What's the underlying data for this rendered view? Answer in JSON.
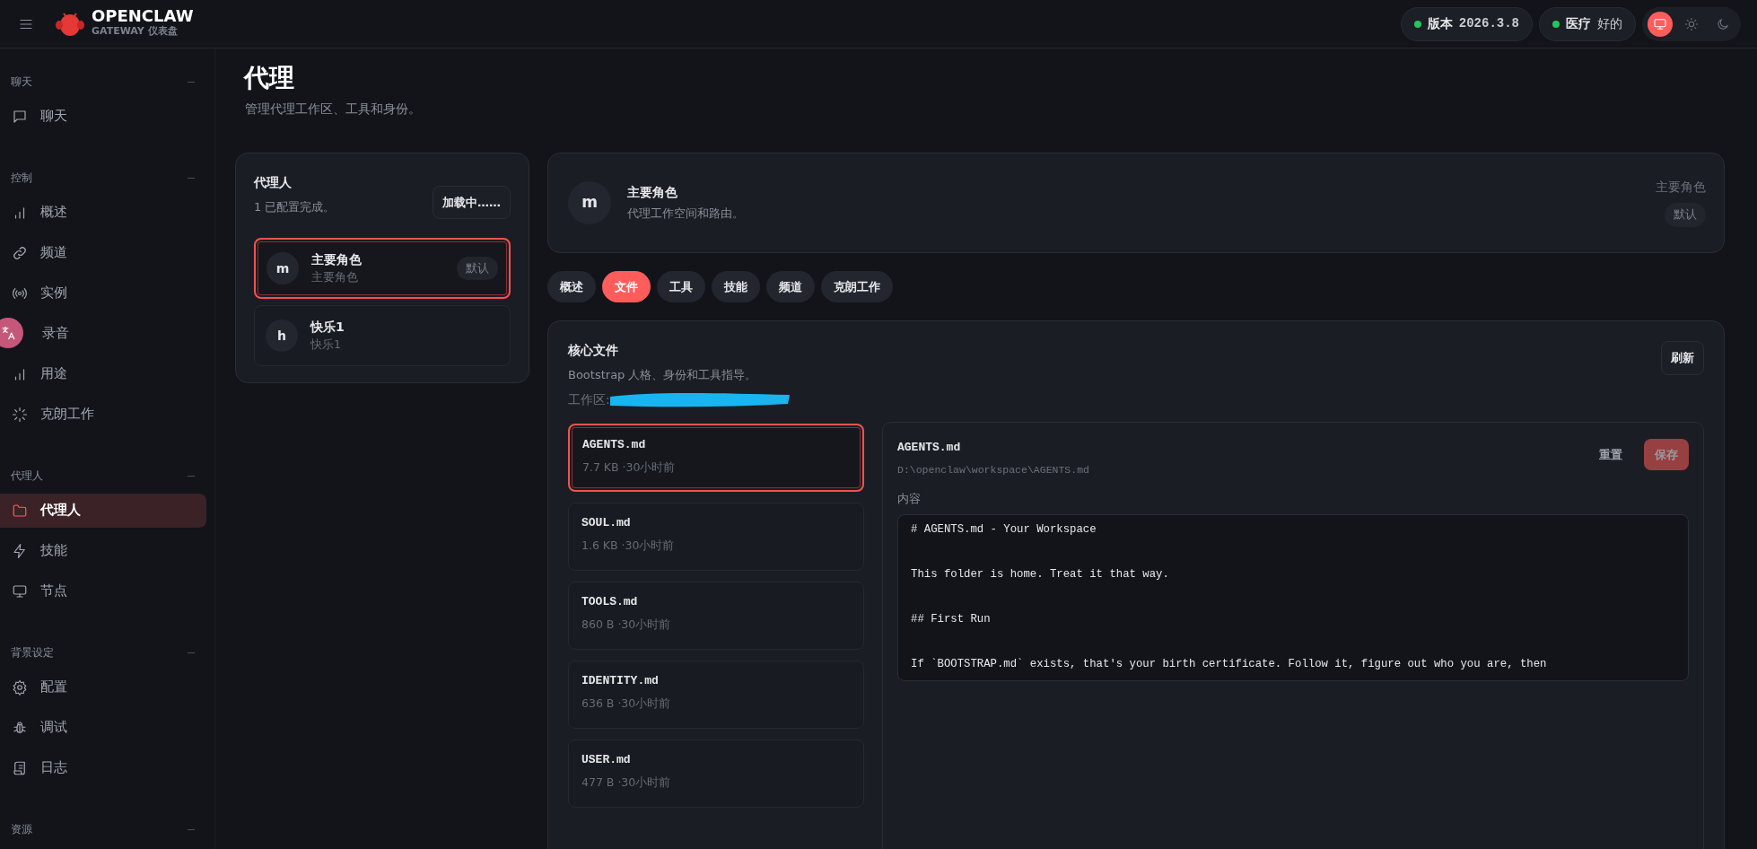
{
  "topbar": {
    "brand": "OPENCLAW",
    "subtitle": "GATEWAY 仪表盘",
    "status": [
      {
        "kind": "version",
        "label": "版本",
        "value": "2026.3.8",
        "color": "#22c55e"
      },
      {
        "kind": "health",
        "label": "医疗",
        "value": "好的",
        "color": "#22c55e"
      }
    ],
    "theme_modes": [
      {
        "selected": true
      },
      {
        "selected": false
      },
      {
        "selected": false
      }
    ]
  },
  "sidebar": {
    "groups": [
      {
        "title": "聊天",
        "items": [
          {
            "label": "聊天",
            "selected": false
          }
        ]
      },
      {
        "title": "控制",
        "items": [
          {
            "label": "概述",
            "selected": false
          },
          {
            "label": "频道",
            "selected": false
          },
          {
            "label": "实例",
            "selected": false
          },
          {
            "label": "录音",
            "selected": false
          },
          {
            "label": "用途",
            "selected": false
          },
          {
            "label": "克朗工作",
            "selected": false
          }
        ]
      },
      {
        "title": "代理人",
        "items": [
          {
            "label": "代理人",
            "selected": true
          },
          {
            "label": "技能",
            "selected": false
          },
          {
            "label": "节点",
            "selected": false
          }
        ]
      },
      {
        "title": "背景设定",
        "items": [
          {
            "label": "配置",
            "selected": false
          },
          {
            "label": "调试",
            "selected": false
          },
          {
            "label": "日志",
            "selected": false
          }
        ]
      },
      {
        "title": "资源"
      }
    ]
  },
  "page": {
    "title": "代理",
    "subtitle": "管理代理工作区、工具和身份。"
  },
  "agents_panel": {
    "title": "代理人",
    "subtitle": "1 已配置完成。",
    "button": "加载中……",
    "agents": [
      {
        "avatar": "m",
        "name": "主要角色",
        "subtitle": "主要角色",
        "badge": "默认",
        "selected": true
      },
      {
        "avatar": "h",
        "name": "快乐1",
        "subtitle": "快乐1",
        "selected": false
      }
    ]
  },
  "agent_header": {
    "avatar": "m",
    "name": "主要角色",
    "description": "代理工作空间和路由。",
    "role": "主要角色",
    "badge": "默认"
  },
  "tabs": [
    {
      "label": "概述",
      "selected": false
    },
    {
      "label": "文件",
      "selected": true
    },
    {
      "label": "工具",
      "selected": false
    },
    {
      "label": "技能",
      "selected": false
    },
    {
      "label": "频道",
      "selected": false
    },
    {
      "label": "克朗工作",
      "selected": false
    }
  ],
  "core_files": {
    "title": "核心文件",
    "subtitle": "Bootstrap 人格、身份和工具指导。",
    "workspace_label": "工作区:",
    "refresh": "刷新",
    "files": [
      {
        "name": "AGENTS.md",
        "meta": "7.7 KB ·30小时前",
        "selected": true
      },
      {
        "name": "SOUL.md",
        "meta": "1.6 KB ·30小时前",
        "selected": false
      },
      {
        "name": "TOOLS.md",
        "meta": "860 B ·30小时前",
        "selected": false
      },
      {
        "name": "IDENTITY.md",
        "meta": "636 B ·30小时前",
        "selected": false
      },
      {
        "name": "USER.md",
        "meta": "477 B ·30小时前",
        "selected": false
      }
    ],
    "editor": {
      "title": "AGENTS.md",
      "path": "D:\\openclaw\\workspace\\AGENTS.md",
      "reset": "重置",
      "save": "保存",
      "save_disabled": true,
      "content_label": "内容",
      "lines": [
        "# AGENTS.md - Your Workspace",
        "This folder is home. Treat it that way.",
        "## First Run",
        "If `BOOTSTRAP.md` exists, that's your birth certificate. Follow it, figure out who you are, then"
      ]
    }
  }
}
